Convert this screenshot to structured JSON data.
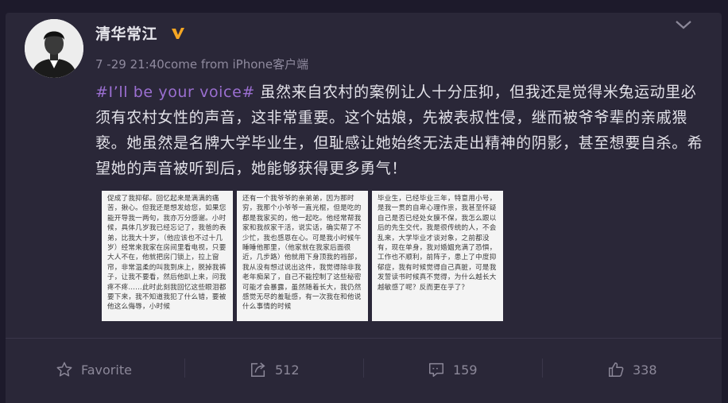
{
  "post": {
    "author": "清华常江",
    "meta": "7 -29 21:40come from iPhone客户端",
    "hashtag": "#I’ll be your voice#",
    "text": " 虽然来自农村的案例让人十分压抑，但我还是觉得米兔运动里必须有农村女性的声音，这非常重要。这个姑娘，先被表叔性侵，继而被爷爷辈的亲戚猥亵。她虽然是名牌大学毕业生，但耻感让她始终无法走出精神的阴影，甚至想要自杀。希望她的声音被听到后，她能够获得更多勇气！",
    "images": [
      {
        "text": "促成了我抑郁。回忆起来是满满的痛苦，揪心。但我还是想发给您，如果您能开导我一两句，我亦万分感谢。小时候，具体几岁我已经忘记了，我爸的表弟，比我大十岁，（他应该也不过十几岁）经常来我家在房间里看电视，只要大人不在，他就把房门锁上，拉上窗帘，非常温柔的叫我到床上，脱掉我裤子，让我不要看，然后他趴上来，问我疼不疼……此时此刻我回忆这些眼泪都要下来，我不知道我犯了什么错，要被他这么侮辱，小时候"
      },
      {
        "text": "还有一个我爷爷的亲弟弟，因为那时穷，我那个小爷爷一直光棍，但是吃的都是我家买的，他一起吃。他经常帮我家和我叔家干活，说实话，确实帮了不少忙，我也感恩在心。可是我小时候午睡睡他那里，（他家就在我家后面很近，几步路）他就用下身顶我的裆部，我从没有想过说出这件，我觉得除非我老年痴呆了，自己不能控制了这些秘密可能才会暴露，虽然随着长大，我仍然感觉无尽的羞耻感，有一次我在和他说什么事情的时候"
      },
      {
        "text": "毕业生，已经毕业三年，特意用小号，是我一贯的自卑心理作祟，我甚至怀疑自己是否已经处女膜不保，我怎么跟以后的先生交代，我是很传统的人，不会乱来，大学毕业才谈对象，之前都没有，现在单身，我对婚姻充满了恐惧，工作也不顺利，前阵子，患上了中度抑郁症，我有时候觉得自己真脏，可是我发誓读书时候真不觉得，为什么越长大越敏感了呢？反而更在乎了？"
      }
    ],
    "actions": {
      "favorite": "Favorite",
      "forward": "512",
      "comment": "159",
      "like": "338"
    }
  },
  "colors": {
    "background": "#1d1a2b",
    "card": "#2a2738",
    "hashtag": "#9b6fd1",
    "verified": "#f5a623"
  }
}
